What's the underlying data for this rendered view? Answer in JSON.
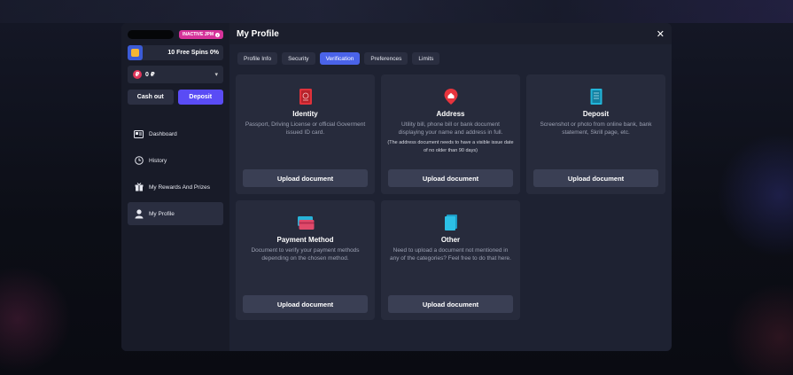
{
  "sidebar": {
    "inactive_badge": "INACTIVE JPM",
    "free_spins": "10 Free Spins 0%",
    "balance": "0 ₽",
    "cash_out": "Cash out",
    "deposit": "Deposit",
    "nav": [
      {
        "label": "Dashboard",
        "icon": "dashboard-icon"
      },
      {
        "label": "History",
        "icon": "clock-icon"
      },
      {
        "label": "My Rewards And Prizes",
        "icon": "gift-icon"
      },
      {
        "label": "My Profile",
        "icon": "user-icon",
        "active": true
      }
    ]
  },
  "header": {
    "title": "My Profile"
  },
  "tabs": [
    {
      "label": "Profile Info"
    },
    {
      "label": "Security"
    },
    {
      "label": "Verification",
      "active": true
    },
    {
      "label": "Preferences"
    },
    {
      "label": "Limits"
    }
  ],
  "cards": [
    {
      "title": "Identity",
      "desc": "Passport, Driving License or official Goverment issued ID card.",
      "note": "",
      "button": "Upload document",
      "icon": "passport-icon"
    },
    {
      "title": "Address",
      "desc": "Utility bill, phone bill or bank document displaying your name and address in full.",
      "note": "(The address document needs to have a visible issue date of no older than 90 days)",
      "button": "Upload document",
      "icon": "location-pin-icon"
    },
    {
      "title": "Deposit",
      "desc": "Screenshot or photo from online bank, bank statement, Skrill page, etc.",
      "note": "",
      "button": "Upload document",
      "icon": "receipt-icon"
    },
    {
      "title": "Payment Method",
      "desc": "Document to verify your payment methods depending on the chosen method.",
      "note": "",
      "button": "Upload document",
      "icon": "credit-card-icon"
    },
    {
      "title": "Other",
      "desc": "Need to upload a document not mentioned in any of the categories? Feel free to do that here.",
      "note": "",
      "button": "Upload document",
      "icon": "document-icon"
    }
  ],
  "colors": {
    "accent": "#4a63e8",
    "deposit_button": "#5a4cf5",
    "badge": "#d6339a"
  }
}
